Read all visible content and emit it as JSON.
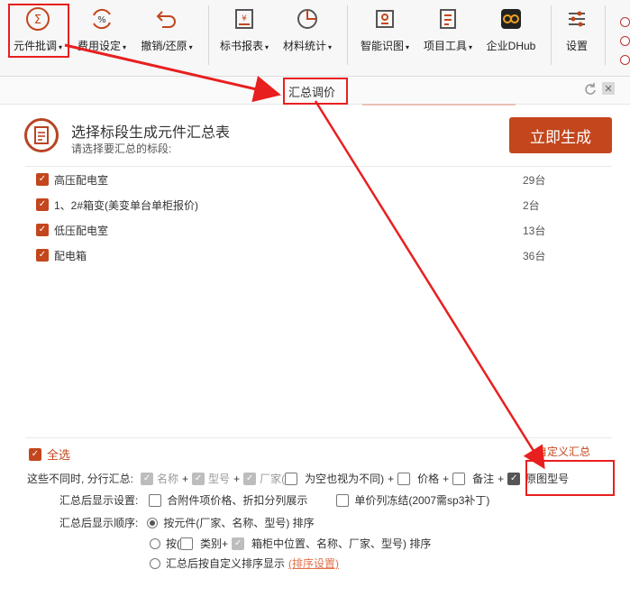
{
  "ribbon": {
    "buttons": [
      {
        "label": "元件批调",
        "icon": "sigma-icon"
      },
      {
        "label": "费用设定",
        "icon": "percent-cycle-icon"
      },
      {
        "label": "撤销/还原",
        "icon": "undo-icon"
      },
      {
        "label": "标书报表",
        "icon": "report-yen-icon"
      },
      {
        "label": "材料统计",
        "icon": "pie-chart-icon"
      },
      {
        "label": "智能识图",
        "icon": "scan-image-icon"
      },
      {
        "label": "项目工具",
        "icon": "document-tools-icon"
      },
      {
        "label": "企业DHub",
        "icon": "dhub-logo-icon"
      },
      {
        "label": "设置",
        "icon": "sliders-icon"
      }
    ]
  },
  "panel": {
    "title": "汇总调价",
    "header_title": "选择标段生成元件汇总表",
    "header_subtitle": "请选择要汇总的标段:",
    "generate_label": "立即生成"
  },
  "sections": [
    {
      "name": "高压配电室",
      "qty": "29台",
      "checked": true
    },
    {
      "name": "1、2#箱变(美变单台单柜报价)",
      "qty": "2台",
      "checked": true
    },
    {
      "name": "低压配电室",
      "qty": "13台",
      "checked": true
    },
    {
      "name": "配电箱",
      "qty": "36台",
      "checked": true
    }
  ],
  "footer": {
    "select_all": "全选",
    "custom_summary": "自定义汇总",
    "row1_label": "这些不同时, 分行汇总:",
    "row1_opts": {
      "name": "名称",
      "plus": "+",
      "model": "型号",
      "maker": "厂家(",
      "empty_diff": "为空也视为不同)",
      "price": "价格",
      "remark": "备注",
      "orig_model": "原图型号"
    },
    "row2_label": "汇总后显示设置:",
    "row2_opt1": "合附件项价格、折扣分列展示",
    "row2_opt2": "单价列冻结(2007需sp3补丁)",
    "row3_label": "汇总后显示顺序:",
    "sort_opt1": "按元件(厂家、名称、型号) 排序",
    "sort_opt2_a": "按(",
    "sort_opt2_b": "类别+",
    "sort_opt2_c": "箱柜中位置、名称、厂家、型号) 排序",
    "sort_opt3": "汇总后按自定义排序显示",
    "sort_link": "(排序设置)"
  }
}
